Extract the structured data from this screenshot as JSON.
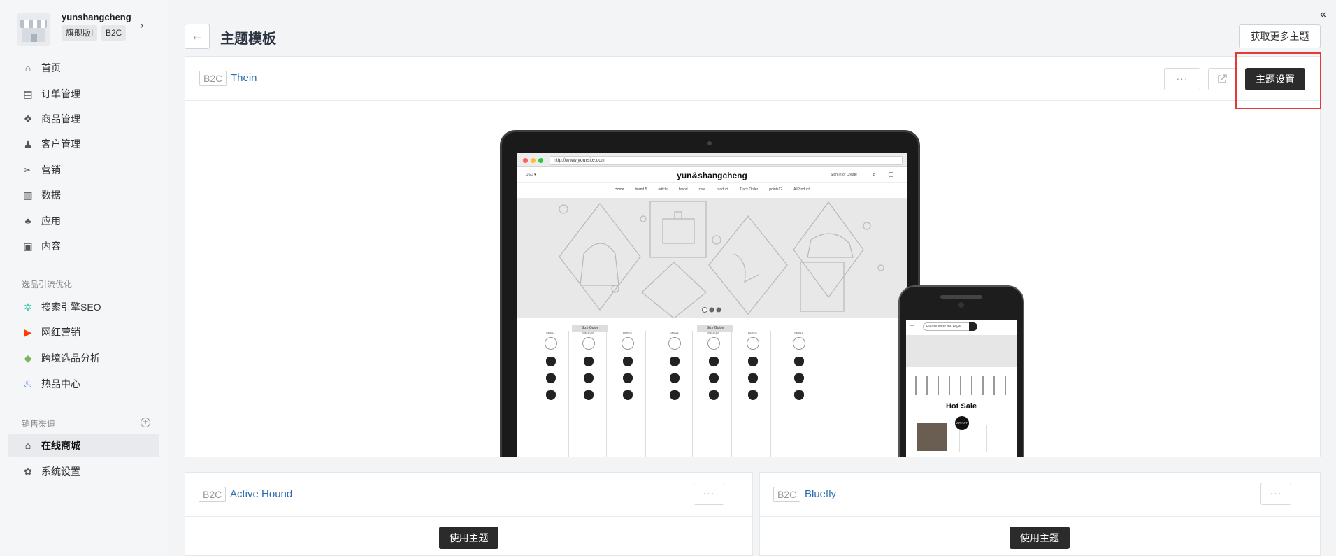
{
  "store": {
    "name": "yunshangcheng",
    "tag1": "旗舰版I",
    "tag2": "B2C"
  },
  "nav": {
    "main": [
      {
        "label": "首页",
        "icon": "home-icon"
      },
      {
        "label": "订单管理",
        "icon": "order-icon"
      },
      {
        "label": "商品管理",
        "icon": "product-icon"
      },
      {
        "label": "客户管理",
        "icon": "customer-icon"
      },
      {
        "label": "营销",
        "icon": "marketing-icon"
      },
      {
        "label": "数据",
        "icon": "data-icon"
      },
      {
        "label": "应用",
        "icon": "apps-icon"
      },
      {
        "label": "内容",
        "icon": "content-icon"
      }
    ],
    "section1": "选品引流优化",
    "optimize": [
      {
        "label": "搜索引擎SEO",
        "icon": "seo-icon"
      },
      {
        "label": "网红营销",
        "icon": "youtube-icon"
      },
      {
        "label": "跨境选品分析",
        "icon": "shopify-icon"
      },
      {
        "label": "热品中心",
        "icon": "flame-icon"
      }
    ],
    "section2": "销售渠道",
    "channels": [
      {
        "label": "在线商城",
        "icon": "store-icon"
      },
      {
        "label": "系统设置",
        "icon": "settings-icon"
      }
    ]
  },
  "header": {
    "title": "主题模板",
    "more_label": "获取更多主题"
  },
  "current_theme": {
    "tag": "B2C",
    "name": "Thein",
    "settings_label": "主题设置",
    "dots": "···",
    "preview": {
      "url": "http://www.yoursite.com",
      "brand": "yun&shangcheng",
      "currency": "USD ▾",
      "signin": "Sign In or Create",
      "menu": [
        "Home",
        "brand 5",
        "article",
        "brand",
        "cate",
        "product",
        "Track Order",
        "points12",
        "AllProduct"
      ],
      "size_guide": "Size Guide",
      "sizes": [
        "SMALL",
        "MEDIUM",
        "LARGE",
        "SMALL",
        "MEDIUM",
        "LARGE",
        "SMALL"
      ],
      "phone_search": "Please enter the keyw",
      "phone_hot": "Hot Sale",
      "phone_badge": "24% OFF"
    }
  },
  "themes": [
    {
      "tag": "B2C",
      "name": "Active Hound",
      "use_label": "使用主题",
      "dots": "···"
    },
    {
      "tag": "B2C",
      "name": "Bluefly",
      "use_label": "使用主题",
      "dots": "···"
    }
  ],
  "colors": {
    "accent": "#2b6cb0",
    "dark_button": "#2b2b2b",
    "highlight": "#e53935"
  }
}
